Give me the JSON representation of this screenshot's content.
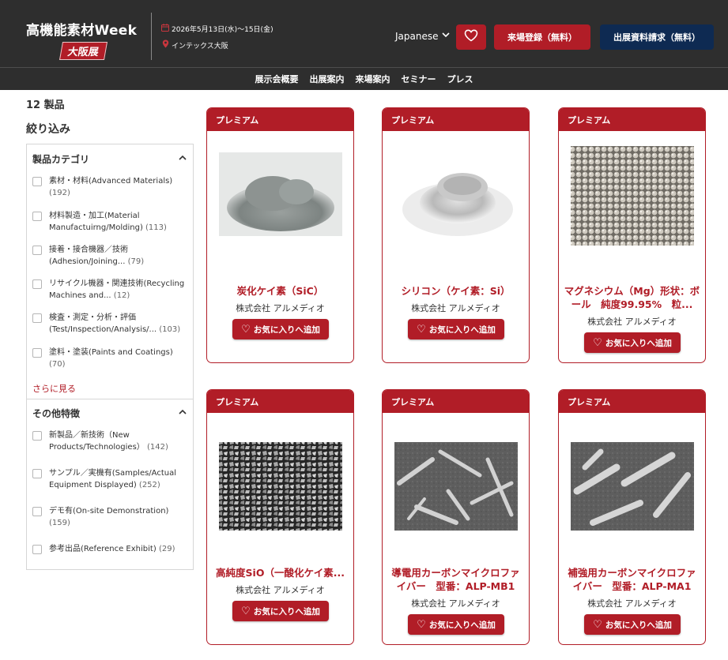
{
  "header": {
    "logo_title": "高機能素材Week",
    "logo_badge": "大阪展",
    "date": "2026年5月13日(水)〜15日(金)",
    "venue": "インテックス大阪",
    "language": "Japanese",
    "register_label": "来場登録（無料）",
    "request_label": "出展資料請求（無料）"
  },
  "nav": [
    "展示会概要",
    "出展案内",
    "来場案内",
    "セミナー",
    "プレス"
  ],
  "sidebar": {
    "count": "12 製品",
    "filter_title": "絞り込み",
    "category_title": "製品カテゴリ",
    "categories": [
      {
        "label": "素材・材料(Advanced Materials)",
        "count": "(192)"
      },
      {
        "label": "材料製造・加工(Material Manufactuirng/Molding)",
        "count": "(113)"
      },
      {
        "label": "接着・接合機器／技術(Adhesion/Joining...",
        "count": "(79)"
      },
      {
        "label": "リサイクル機器・関連技術(Recycling Machines and...",
        "count": "(12)"
      },
      {
        "label": "検査・測定・分析・評価(Test/Inspection/Analysis/...",
        "count": "(103)"
      },
      {
        "label": "塗料・塗装(Paints and Coatings)",
        "count": "(70)"
      }
    ],
    "more_label": "さらに見る",
    "features_title": "その他特徴",
    "features": [
      {
        "label": "新製品／新技術（New Products/Technologies）",
        "count": "(142)"
      },
      {
        "label": "サンプル／実機有(Samples/Actual Equipment Displayed)",
        "count": "(252)"
      },
      {
        "label": "デモ有(On-site Demonstration)",
        "count": "(159)"
      },
      {
        "label": "参考出品(Reference Exhibit)",
        "count": "(29)"
      }
    ]
  },
  "products": [
    {
      "badge": "プレミアム",
      "name": "炭化ケイ素（SiC）",
      "company": "株式会社 アルメディオ",
      "fav_label": "お気に入りへ追加",
      "image": "gray-powder"
    },
    {
      "badge": "プレミアム",
      "name": "シリコン（ケイ素：Si）",
      "company": "株式会社 アルメディオ",
      "fav_label": "お気に入りへ追加",
      "image": "silver-powder"
    },
    {
      "badge": "プレミアム",
      "name": "マグネシウム（Mg）形状：ボール　純度99.95%　粒...",
      "company": "株式会社 アルメディオ",
      "fav_label": "お気に入りへ追加",
      "image": "metal-balls"
    },
    {
      "badge": "プレミアム",
      "name": "高純度SiO（一酸化ケイ素...",
      "company": "株式会社 アルメディオ",
      "fav_label": "お気に入りへ追加",
      "image": "granules"
    },
    {
      "badge": "プレミアム",
      "name": "導電用カーボンマイクロファイバー　型番：ALP-MB1",
      "company": "株式会社 アルメディオ",
      "fav_label": "お気に入りへ追加",
      "image": "fiber-sem-thin"
    },
    {
      "badge": "プレミアム",
      "name": "補強用カーボンマイクロファイバー　型番：ALP-MA1",
      "company": "株式会社 アルメディオ",
      "fav_label": "お気に入りへ追加",
      "image": "fiber-sem-thick"
    }
  ],
  "colors": {
    "brand_red": "#b11d27",
    "navy": "#0e2a52",
    "header_bg": "#2e2e2e"
  }
}
